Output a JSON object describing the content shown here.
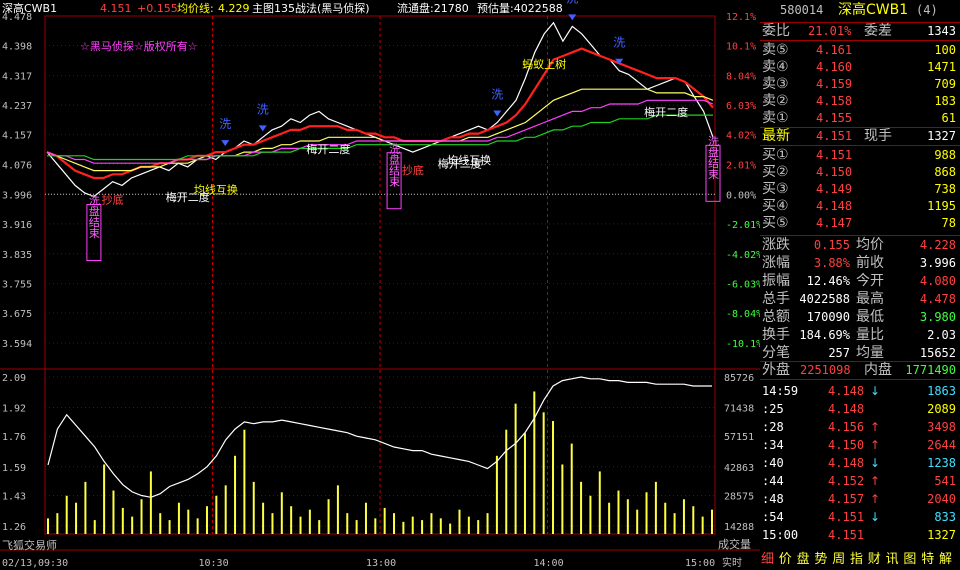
{
  "header": {
    "name": "深高CWB1",
    "price_label": "4.151",
    "change_label": "+0.155",
    "avg_label": "均价线:",
    "avg_value": "4.229",
    "main_chart": "主图135战法(黑马侦探)",
    "float_label": "流通盘:21780",
    "estimate_label": "预估量:4022588"
  },
  "watermark": "☆黑马侦探☆版权所有☆",
  "chart_data": {
    "type": "line",
    "price_axis": {
      "ticks": [
        "4.478",
        "4.398",
        "4.317",
        "4.237",
        "4.157",
        "4.076",
        "3.996",
        "3.916",
        "3.835",
        "3.755",
        "3.675",
        "3.594"
      ],
      "ylim": [
        3.594,
        4.478
      ],
      "pct_ticks": [
        "12.1%",
        "10.1%",
        "8.04%",
        "6.03%",
        "4.02%",
        "2.01%",
        "0.00%",
        "-2.01%",
        "-4.02%",
        "-6.03%",
        "-8.04%",
        "-10.1%"
      ],
      "pct_neutral": "0.00%",
      "prev_close": 3.996
    },
    "volume_axis": {
      "ticks": [
        "2.09",
        "1.92",
        "1.76",
        "1.59",
        "1.43",
        "1.26"
      ],
      "right_ticks": [
        "85726",
        "71438",
        "57151",
        "42863",
        "28575",
        "14288"
      ],
      "right_label": "成交量",
      "ylim": [
        1.26,
        2.09
      ],
      "vol_max": 85726
    },
    "time_labels": [
      "09:30",
      "10:30",
      "13:00",
      "14:00",
      "15:00"
    ],
    "date_label": "02/13,",
    "mode_label": "实时",
    "series": [
      {
        "color": "#ffffff",
        "values": [
          4.11,
          4.08,
          4.05,
          4.02,
          4.0,
          3.99,
          4.01,
          4.03,
          4.02,
          4.04,
          4.05,
          4.06,
          4.07,
          4.06,
          4.08,
          4.07,
          4.09,
          4.1,
          4.09,
          4.11,
          4.12,
          4.14,
          4.13,
          4.15,
          4.17,
          4.18,
          4.2,
          4.19,
          4.21,
          4.22,
          4.2,
          4.19,
          4.18,
          4.17,
          4.16,
          4.15,
          4.14,
          4.13,
          4.12,
          4.11,
          4.12,
          4.13,
          4.14,
          4.15,
          4.16,
          4.17,
          4.18,
          4.17,
          4.19,
          4.22,
          4.25,
          4.31,
          4.38,
          4.43,
          4.46,
          4.41,
          4.45,
          4.43,
          4.4,
          4.37,
          4.36,
          4.33,
          4.32,
          4.3,
          4.28,
          4.29,
          4.3,
          4.31,
          4.3,
          4.26,
          4.22,
          4.15
        ]
      },
      {
        "color": "#ff2020",
        "values": [
          4.11,
          4.1,
          4.08,
          4.06,
          4.05,
          4.04,
          4.04,
          4.05,
          4.05,
          4.06,
          4.07,
          4.07,
          4.08,
          4.08,
          4.09,
          4.09,
          4.1,
          4.1,
          4.11,
          4.11,
          4.12,
          4.13,
          4.13,
          4.14,
          4.15,
          4.16,
          4.17,
          4.17,
          4.18,
          4.18,
          4.18,
          4.18,
          4.17,
          4.17,
          4.16,
          4.16,
          4.15,
          4.15,
          4.14,
          4.14,
          4.14,
          4.14,
          4.14,
          4.15,
          4.15,
          4.16,
          4.16,
          4.17,
          4.18,
          4.19,
          4.21,
          4.24,
          4.28,
          4.32,
          4.36,
          4.37,
          4.38,
          4.39,
          4.38,
          4.37,
          4.36,
          4.35,
          4.34,
          4.33,
          4.32,
          4.31,
          4.31,
          4.31,
          4.3,
          4.28,
          4.26,
          4.23
        ]
      },
      {
        "color": "#ffff60",
        "values": [
          4.11,
          4.1,
          4.09,
          4.08,
          4.07,
          4.06,
          4.06,
          4.06,
          4.06,
          4.06,
          4.07,
          4.07,
          4.07,
          4.08,
          4.08,
          4.08,
          4.09,
          4.09,
          4.1,
          4.1,
          4.1,
          4.11,
          4.11,
          4.12,
          4.12,
          4.13,
          4.13,
          4.14,
          4.14,
          4.14,
          4.15,
          4.15,
          4.15,
          4.15,
          4.15,
          4.15,
          4.14,
          4.14,
          4.14,
          4.14,
          4.14,
          4.14,
          4.14,
          4.14,
          4.14,
          4.15,
          4.15,
          4.15,
          4.16,
          4.17,
          4.18,
          4.19,
          4.21,
          4.23,
          4.25,
          4.26,
          4.27,
          4.28,
          4.28,
          4.28,
          4.28,
          4.28,
          4.28,
          4.28,
          4.28,
          4.27,
          4.27,
          4.27,
          4.27,
          4.26,
          4.26,
          4.25
        ]
      },
      {
        "color": "#ff40ff",
        "values": [
          4.11,
          4.1,
          4.1,
          4.09,
          4.09,
          4.08,
          4.08,
          4.08,
          4.08,
          4.08,
          4.08,
          4.08,
          4.08,
          4.08,
          4.09,
          4.09,
          4.09,
          4.09,
          4.1,
          4.1,
          4.1,
          4.1,
          4.11,
          4.11,
          4.11,
          4.12,
          4.12,
          4.12,
          4.13,
          4.13,
          4.13,
          4.13,
          4.13,
          4.14,
          4.14,
          4.14,
          4.14,
          4.14,
          4.14,
          4.14,
          4.14,
          4.14,
          4.14,
          4.14,
          4.14,
          4.14,
          4.14,
          4.14,
          4.15,
          4.15,
          4.16,
          4.17,
          4.18,
          4.19,
          4.2,
          4.21,
          4.22,
          4.22,
          4.23,
          4.23,
          4.24,
          4.24,
          4.24,
          4.24,
          4.25,
          4.25,
          4.25,
          4.25,
          4.25,
          4.25,
          4.25,
          4.24
        ]
      },
      {
        "color": "#20d020",
        "values": [
          4.1,
          4.1,
          4.1,
          4.1,
          4.1,
          4.09,
          4.09,
          4.09,
          4.09,
          4.09,
          4.09,
          4.09,
          4.09,
          4.09,
          4.09,
          4.1,
          4.1,
          4.1,
          4.1,
          4.1,
          4.1,
          4.1,
          4.1,
          4.11,
          4.11,
          4.11,
          4.11,
          4.12,
          4.12,
          4.12,
          4.12,
          4.12,
          4.12,
          4.13,
          4.13,
          4.13,
          4.13,
          4.13,
          4.13,
          4.13,
          4.13,
          4.13,
          4.13,
          4.13,
          4.13,
          4.13,
          4.13,
          4.13,
          4.14,
          4.14,
          4.14,
          4.15,
          4.15,
          4.16,
          4.17,
          4.17,
          4.18,
          4.18,
          4.19,
          4.19,
          4.19,
          4.2,
          4.2,
          4.2,
          4.2,
          4.21,
          4.21,
          4.21,
          4.21,
          4.21,
          4.21,
          4.21
        ]
      }
    ],
    "volume_line": [
      1.6,
      1.8,
      1.88,
      1.82,
      1.76,
      1.7,
      1.62,
      1.55,
      1.49,
      1.45,
      1.43,
      1.42,
      1.44,
      1.48,
      1.5,
      1.52,
      1.55,
      1.59,
      1.65,
      1.74,
      1.8,
      1.84,
      1.83,
      1.84,
      1.84,
      1.85,
      1.84,
      1.83,
      1.82,
      1.81,
      1.8,
      1.79,
      1.78,
      1.76,
      1.75,
      1.74,
      1.72,
      1.7,
      1.69,
      1.68,
      1.68,
      1.66,
      1.65,
      1.64,
      1.63,
      1.62,
      1.6,
      1.58,
      1.62,
      1.68,
      1.72,
      1.78,
      1.86,
      1.96,
      2.04,
      2.07,
      2.08,
      2.09,
      2.08,
      2.08,
      2.07,
      2.07,
      2.06,
      2.06,
      2.06,
      2.05,
      2.05,
      2.05,
      2.05,
      2.04,
      2.04,
      2.04
    ],
    "volume_bars": [
      9000,
      12000,
      22000,
      18000,
      30000,
      8000,
      40000,
      25000,
      15000,
      10000,
      20000,
      36000,
      12000,
      8000,
      18000,
      14000,
      9000,
      16000,
      22000,
      28000,
      45000,
      60000,
      30000,
      18000,
      12000,
      24000,
      16000,
      10000,
      14000,
      8000,
      20000,
      28000,
      12000,
      8000,
      18000,
      9000,
      15000,
      12000,
      7000,
      10000,
      8000,
      12000,
      9000,
      6000,
      14000,
      10000,
      8000,
      12000,
      45000,
      60000,
      75000,
      58000,
      82000,
      70000,
      65000,
      40000,
      52000,
      30000,
      22000,
      36000,
      18000,
      25000,
      20000,
      14000,
      24000,
      30000,
      18000,
      12000,
      20000,
      16000,
      10000,
      14000
    ],
    "annotations": [
      {
        "text": "洗盘结束",
        "color": "#ff60ff",
        "idx": 5
      },
      {
        "text": "洗盘结束",
        "color": "#ff60ff",
        "idx": 37
      },
      {
        "text": "洗盘结束",
        "color": "#ff60ff",
        "idx": 71
      },
      {
        "text": "抄底",
        "color": "#ff4040",
        "idx": 7
      },
      {
        "text": "抄底",
        "color": "#ff4040",
        "idx": 39
      },
      {
        "text": "均线互换",
        "color": "#ffff00",
        "idx": 18
      },
      {
        "text": "梅开二度",
        "color": "#ffffff",
        "idx": 15
      },
      {
        "text": "梅开二度",
        "color": "#ffffff",
        "idx": 30
      },
      {
        "text": "梅开二度",
        "color": "#ffffff",
        "idx": 44
      },
      {
        "text": "梅开二度",
        "color": "#ffffff",
        "idx": 66
      },
      {
        "text": "均线互换",
        "color": "#ffffff",
        "idx": 45
      },
      {
        "text": "蚂蚁上树",
        "color": "#ffff00",
        "idx": 53
      },
      {
        "text": "洗",
        "color": "#4060ff",
        "idx": 19
      },
      {
        "text": "洗",
        "color": "#4060ff",
        "idx": 23
      },
      {
        "text": "洗",
        "color": "#4060ff",
        "idx": 48
      },
      {
        "text": "洗",
        "color": "#4060ff",
        "idx": 56
      },
      {
        "text": "洗",
        "color": "#4060ff",
        "idx": 61
      }
    ]
  },
  "side": {
    "code": "580014",
    "name": "深高CWB1",
    "tag": "(4)",
    "weibi_label": "委比",
    "weibi_value": "21.01%",
    "weicha_label": "委差",
    "weicha_value": "1343",
    "asks": [
      {
        "label": "卖⑤",
        "price": "4.161",
        "vol": "100"
      },
      {
        "label": "卖④",
        "price": "4.160",
        "vol": "1471"
      },
      {
        "label": "卖③",
        "price": "4.159",
        "vol": "709"
      },
      {
        "label": "卖②",
        "price": "4.158",
        "vol": "183"
      },
      {
        "label": "卖①",
        "price": "4.155",
        "vol": "61"
      }
    ],
    "latest_label": "最新",
    "latest_value": "4.151",
    "now_label": "现手",
    "now_value": "1327",
    "bids": [
      {
        "label": "买①",
        "price": "4.151",
        "vol": "988"
      },
      {
        "label": "买②",
        "price": "4.150",
        "vol": "868"
      },
      {
        "label": "买③",
        "price": "4.149",
        "vol": "738"
      },
      {
        "label": "买④",
        "price": "4.148",
        "vol": "1195"
      },
      {
        "label": "买⑤",
        "price": "4.147",
        "vol": "78"
      }
    ],
    "stats": [
      {
        "l1": "涨跌",
        "v1": "0.155",
        "c1": "#ff4040",
        "l2": "均价",
        "v2": "4.228",
        "c2": "#ff4040"
      },
      {
        "l1": "涨幅",
        "v1": "3.88%",
        "c1": "#ff4040",
        "l2": "前收",
        "v2": "3.996",
        "c2": "#ffffff"
      },
      {
        "l1": "振幅",
        "v1": "12.46%",
        "c1": "#ffffff",
        "l2": "今开",
        "v2": "4.080",
        "c2": "#ff4040"
      },
      {
        "l1": "总手",
        "v1": "4022588",
        "c1": "#ffffff",
        "l2": "最高",
        "v2": "4.478",
        "c2": "#ff4040"
      },
      {
        "l1": "总额",
        "v1": "170090",
        "c1": "#ffffff",
        "l2": "最低",
        "v2": "3.980",
        "c2": "#40ff40"
      },
      {
        "l1": "换手",
        "v1": "184.69%",
        "c1": "#ffffff",
        "l2": "量比",
        "v2": "2.03",
        "c2": "#ffffff"
      },
      {
        "l1": "分笔",
        "v1": "257",
        "c1": "#ffffff",
        "l2": "均量",
        "v2": "15652",
        "c2": "#ffffff"
      }
    ],
    "outer_label": "外盘",
    "outer_value": "2251098",
    "inner_label": "内盘",
    "inner_value": "1771490",
    "ticks": [
      {
        "time": "14:59",
        "price": "4.148",
        "dir": "down",
        "vol": "1863"
      },
      {
        "time": ":25",
        "price": "4.148",
        "dir": "",
        "vol": "2089"
      },
      {
        "time": ":28",
        "price": "4.156",
        "dir": "up",
        "vol": "3498"
      },
      {
        "time": ":34",
        "price": "4.150",
        "dir": "up",
        "vol": "2644"
      },
      {
        "time": ":40",
        "price": "4.148",
        "dir": "down",
        "vol": "1238"
      },
      {
        "time": ":44",
        "price": "4.152",
        "dir": "up",
        "vol": "541"
      },
      {
        "time": ":48",
        "price": "4.157",
        "dir": "up",
        "vol": "2040"
      },
      {
        "time": ":54",
        "price": "4.151",
        "dir": "down",
        "vol": "833"
      },
      {
        "time": "15:00",
        "price": "4.151",
        "dir": "",
        "vol": "1327"
      }
    ],
    "tabs": [
      "细",
      "价",
      "盘",
      "势",
      "周",
      "指",
      "财",
      "讯",
      "图",
      "特",
      "解"
    ]
  },
  "footer": {
    "source_label": "飞狐交易师"
  }
}
